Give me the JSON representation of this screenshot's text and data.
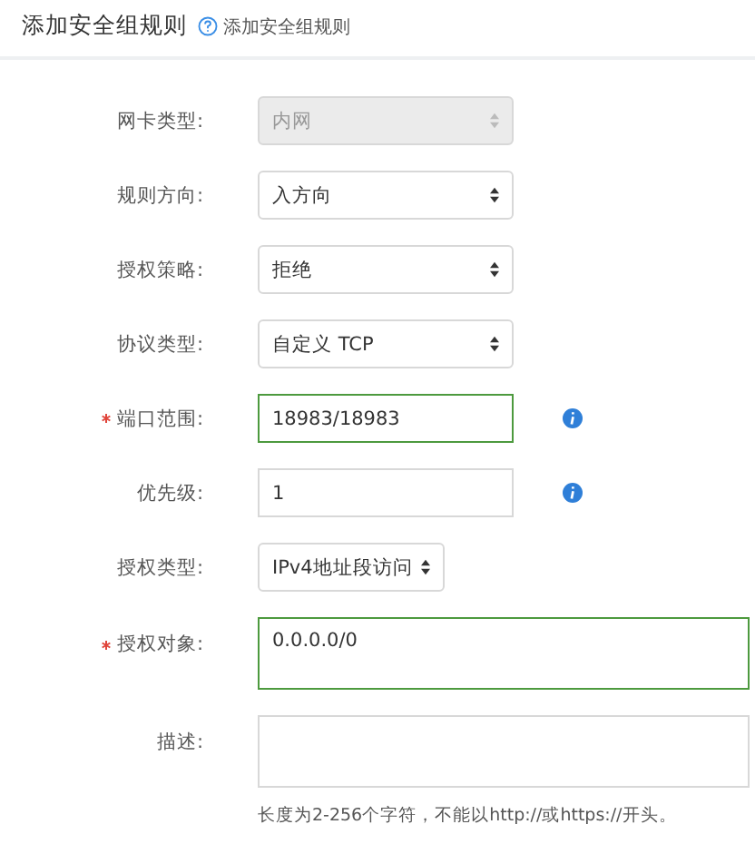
{
  "header": {
    "title": "添加安全组规则",
    "help_link": "添加安全组规则"
  },
  "fields": [
    {
      "kind": "select",
      "label": "网卡类型:",
      "value": "内网",
      "disabled": true,
      "required": false,
      "valid": false,
      "info": false,
      "compact": false
    },
    {
      "kind": "select",
      "label": "规则方向:",
      "value": "入方向",
      "disabled": false,
      "required": false,
      "valid": false,
      "info": false,
      "compact": false
    },
    {
      "kind": "select",
      "label": "授权策略:",
      "value": "拒绝",
      "disabled": false,
      "required": false,
      "valid": false,
      "info": false,
      "compact": false
    },
    {
      "kind": "select",
      "label": "协议类型:",
      "value": "自定义 TCP",
      "disabled": false,
      "required": false,
      "valid": false,
      "info": false,
      "compact": false
    },
    {
      "kind": "input",
      "label": "端口范围:",
      "value": "18983/18983",
      "disabled": false,
      "required": true,
      "valid": true,
      "info": true
    },
    {
      "kind": "input",
      "label": "优先级:",
      "value": "1",
      "disabled": false,
      "required": false,
      "valid": false,
      "info": true
    },
    {
      "kind": "select",
      "label": "授权类型:",
      "value": "IPv4地址段访问",
      "disabled": false,
      "required": false,
      "valid": false,
      "info": false,
      "compact": true
    },
    {
      "kind": "textarea",
      "label": "授权对象:",
      "value": "0.0.0.0/0",
      "disabled": false,
      "required": true,
      "valid": true,
      "info": false
    },
    {
      "kind": "textarea",
      "label": "描述:",
      "disabled": false,
      "required": false,
      "valid": false,
      "info": false,
      "hint": "长度为2-256个字符，不能以http://或https://开头。"
    }
  ]
}
